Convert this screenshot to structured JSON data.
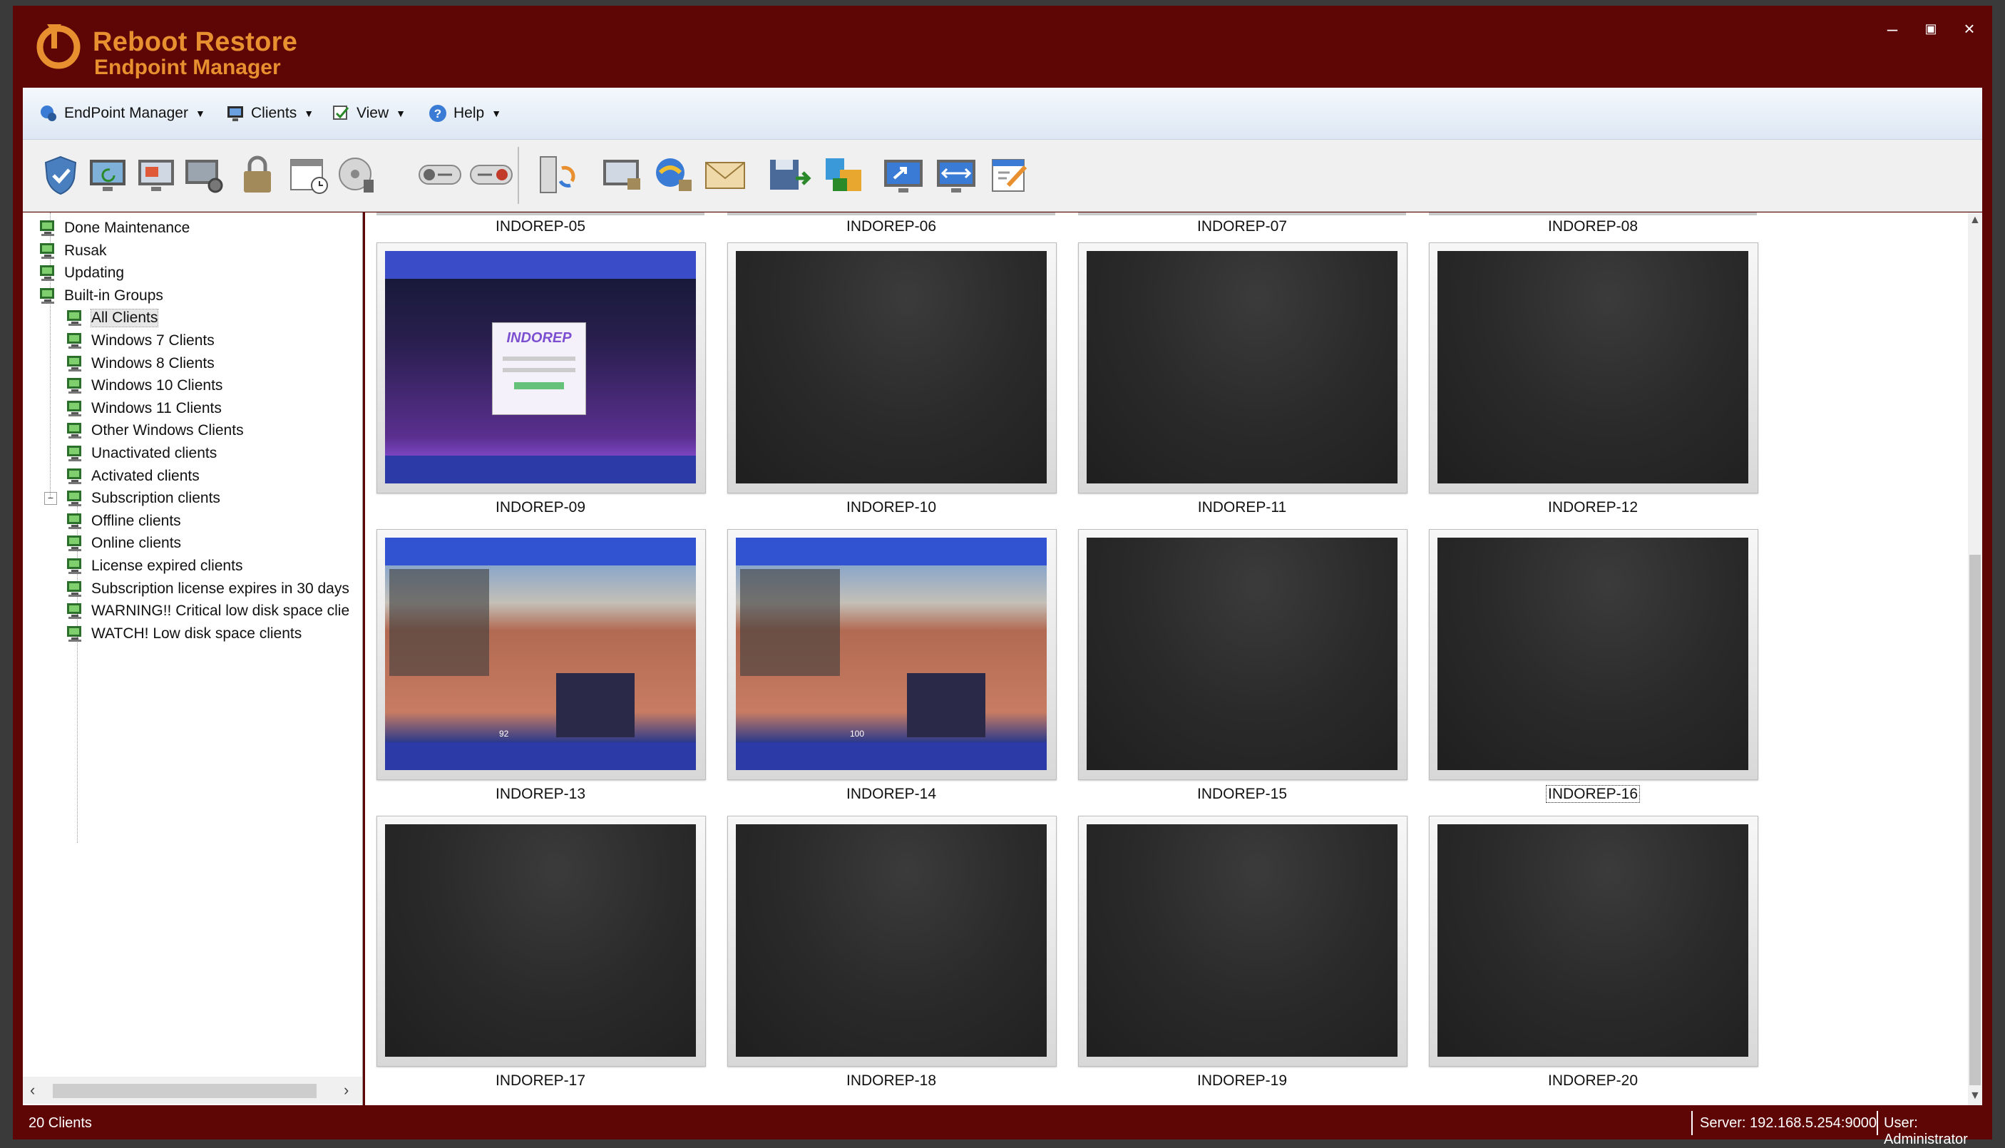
{
  "app": {
    "title_line1": "Reboot Restore",
    "title_line2": "Endpoint Manager",
    "brand_color": "#5e0505",
    "accent_color": "#e8902f"
  },
  "window_controls": {
    "minimize": "–",
    "maximize": "▣",
    "close": "×"
  },
  "menu": [
    {
      "label": "EndPoint Manager",
      "icon": "endpoint-manager-icon"
    },
    {
      "label": "Clients",
      "icon": "clients-icon"
    },
    {
      "label": "View",
      "icon": "view-icon"
    },
    {
      "label": "Help",
      "icon": "help-icon"
    }
  ],
  "toolbar": [
    "protect-shield-icon",
    "restore-screen-icon",
    "remote-desktop-icon",
    "client-settings-icon",
    "lock-icon",
    "schedule-icon",
    "disk-cleanup-icon",
    "toggle-off-icon",
    "toggle-on-icon",
    "update-client-icon",
    "monitor-lock-icon",
    "internet-lock-icon",
    "send-message-icon",
    "save-export-icon",
    "deploy-icon",
    "share-screen-icon",
    "resize-icon",
    "tasks-icon"
  ],
  "tree": {
    "items": [
      {
        "label": "Done Maintenance",
        "level": 1
      },
      {
        "label": "Rusak",
        "level": 1
      },
      {
        "label": "Updating",
        "level": 1
      },
      {
        "label": "Built-in Groups",
        "level": 0
      },
      {
        "label": "All Clients",
        "level": 2,
        "selected": true
      },
      {
        "label": "Windows 7 Clients",
        "level": 2
      },
      {
        "label": "Windows 8 Clients",
        "level": 2
      },
      {
        "label": "Windows 10 Clients",
        "level": 2
      },
      {
        "label": "Windows 11 Clients",
        "level": 2
      },
      {
        "label": "Other Windows Clients",
        "level": 2
      },
      {
        "label": "Unactivated clients",
        "level": 2
      },
      {
        "label": "Activated clients",
        "level": 2
      },
      {
        "label": "Subscription clients",
        "level": 2
      },
      {
        "label": "Offline clients",
        "level": 2
      },
      {
        "label": "Online clients",
        "level": 2
      },
      {
        "label": "License expired clients",
        "level": 2
      },
      {
        "label": "Subscription license expires in 30 days",
        "level": 2
      },
      {
        "label": "WARNING!! Critical low disk space clie",
        "level": 2
      },
      {
        "label": "WATCH! Low disk space clients",
        "level": 2
      }
    ]
  },
  "clients": {
    "top_row_labels": [
      "INDOREP-05",
      "INDOREP-06",
      "INDOREP-07",
      "INDOREP-08"
    ],
    "cards": [
      {
        "name": "INDOREP-09",
        "screen": "login"
      },
      {
        "name": "INDOREP-10",
        "screen": "off"
      },
      {
        "name": "INDOREP-11",
        "screen": "off"
      },
      {
        "name": "INDOREP-12",
        "screen": "off"
      },
      {
        "name": "INDOREP-13",
        "screen": "game"
      },
      {
        "name": "INDOREP-14",
        "screen": "game"
      },
      {
        "name": "INDOREP-15",
        "screen": "off"
      },
      {
        "name": "INDOREP-16",
        "screen": "off",
        "selected": true
      },
      {
        "name": "INDOREP-17",
        "screen": "off"
      },
      {
        "name": "INDOREP-18",
        "screen": "off"
      },
      {
        "name": "INDOREP-19",
        "screen": "off"
      },
      {
        "name": "INDOREP-20",
        "screen": "off"
      }
    ],
    "login_screen_logo": "INDOREP",
    "game_hud_text_13": "92",
    "game_hud_text_14": "100"
  },
  "status": {
    "clients_count": "20 Clients",
    "server": "Server: 192.168.5.254:9000",
    "user": "User: Administrator"
  }
}
